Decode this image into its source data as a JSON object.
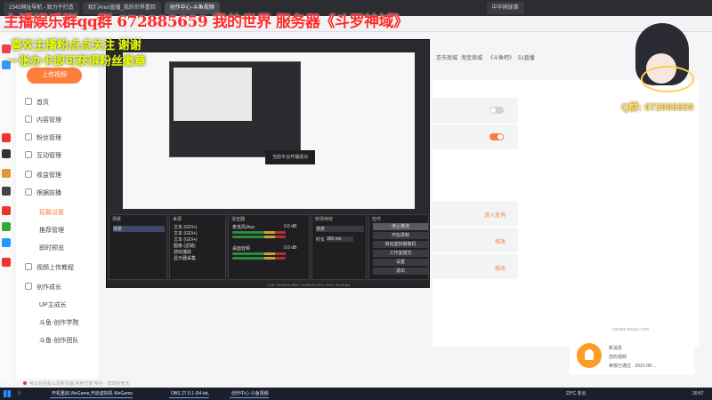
{
  "browser": {
    "tabs": [
      "2345网址导航 - 致力于打造",
      "我们Anor直播_我的世界重回",
      "创作中心-斗鱼视频"
    ],
    "right_tab": "中华网球事",
    "right_tab2": "51直播"
  },
  "bookmarks": [
    {
      "label": "京东商城"
    },
    {
      "label": "淘宝商城"
    },
    {
      "label": "《斗鱼吧》"
    },
    {
      "label": "51直播"
    }
  ],
  "banner": {
    "line1": "主播娱乐群qq群 672885659   我的世界 服务器《斗罗神域》",
    "line2": "喜欢主播粉点点关注 谢谢",
    "line3": "一张办卡即可获得粉丝徽章"
  },
  "avatar": {
    "qq_tag": "Q群: 672885659"
  },
  "sidebar": {
    "upload_label": "上传视频",
    "items": [
      {
        "label": "首页",
        "icon": "home-icon"
      },
      {
        "label": "内容管理",
        "icon": "content-icon"
      },
      {
        "label": "粉丝管理",
        "icon": "fans-icon"
      },
      {
        "label": "互动管理",
        "icon": "interact-icon"
      },
      {
        "label": "收益管理",
        "icon": "income-icon"
      },
      {
        "label": "根据前播",
        "icon": "live-icon"
      }
    ],
    "sub_items": [
      {
        "label": "招募设置",
        "active": true
      },
      {
        "label": "推荐管理",
        "active": false
      },
      {
        "label": "即时预览",
        "active": false
      }
    ],
    "more_items": [
      {
        "label": "视频上传教程",
        "icon": "tutorial-icon"
      },
      {
        "label": "创作成长",
        "icon": "growth-icon"
      }
    ],
    "growth_sub": [
      {
        "label": "UP主成长"
      },
      {
        "label": "斗鱼·创作学院"
      },
      {
        "label": "斗鱼·创作团队"
      }
    ]
  },
  "settings": {
    "toggle1_on": false,
    "toggle2_on": true,
    "link1": "进入查询",
    "link2": "修改",
    "link3": "修改"
  },
  "obs": {
    "preview_overlay": "当前平台开播成功",
    "scenes_title": "场景",
    "scene_item": "场景",
    "sources_title": "来源",
    "sources": [
      "文本 (GDI+)",
      "文本 (GDI+)",
      "文本 (GDI+)",
      "图像 (滤镜)",
      "游戏捕获",
      "显示器采集"
    ],
    "mixer_title": "混音器",
    "mixer": [
      {
        "name": "麦克风/Aux",
        "db": "0.0 dB"
      },
      {
        "name": "桌面音频",
        "db": "0.0 dB"
      }
    ],
    "transitions_title": "转场特效",
    "transition_type": "渐变",
    "duration_label": "时长",
    "duration_value": "300 ms",
    "controls_title": "控件",
    "controls": [
      "停止推流",
      "开始录制",
      "启动虚拟摄像机",
      "工作室模式",
      "设置",
      "退出"
    ],
    "status": "LIVE: 00:00:00   REC: 00:00:00   CPU: 3.9%, 30.00 fps"
  },
  "notification": {
    "title": "新消息",
    "line1": "您的视频",
    "line2": "审核已通过 · 2021-08-..."
  },
  "footer_link": "creator.douyu.com",
  "bottom_status": "可以在回车以及新页面  内容已复  所在：您现在暂无",
  "taskbar": {
    "items": [
      {
        "label": "开机重启,WeGame,开启虚拟机"
      },
      {
        "label": "WeGame"
      },
      {
        "label": "OBS 27.0.1 (64-bit,"
      },
      {
        "label": "创作中心-斗鱼视频"
      }
    ],
    "weather": "23°C 多云",
    "time": "20:57"
  }
}
